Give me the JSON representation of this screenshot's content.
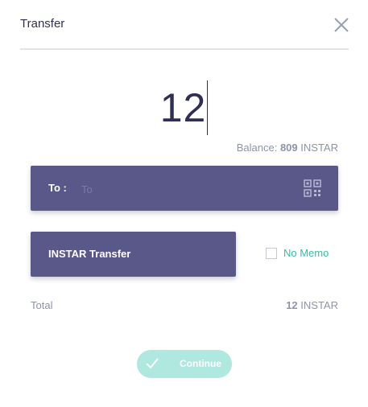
{
  "header": {
    "title": "Transfer"
  },
  "amount": {
    "value": "12"
  },
  "balance": {
    "label": "Balance:",
    "value": "809",
    "unit": "INSTAR"
  },
  "recipient": {
    "label": "To :",
    "placeholder": "To",
    "value": ""
  },
  "memo": {
    "label": "INSTAR Transfer",
    "no_memo_label": "No Memo"
  },
  "total": {
    "label": "Total",
    "value": "12",
    "unit": "INSTAR"
  },
  "actions": {
    "continue_label": "Continue"
  },
  "icons": {
    "close": "close-icon",
    "qr": "qr-code-icon",
    "check": "check-icon"
  },
  "colors": {
    "primary": "#5a5789",
    "text_dark": "#2f2f55",
    "muted": "#8b95a8",
    "accent_teal": "#2fc2a8",
    "continue_bg": "#aee8df"
  }
}
